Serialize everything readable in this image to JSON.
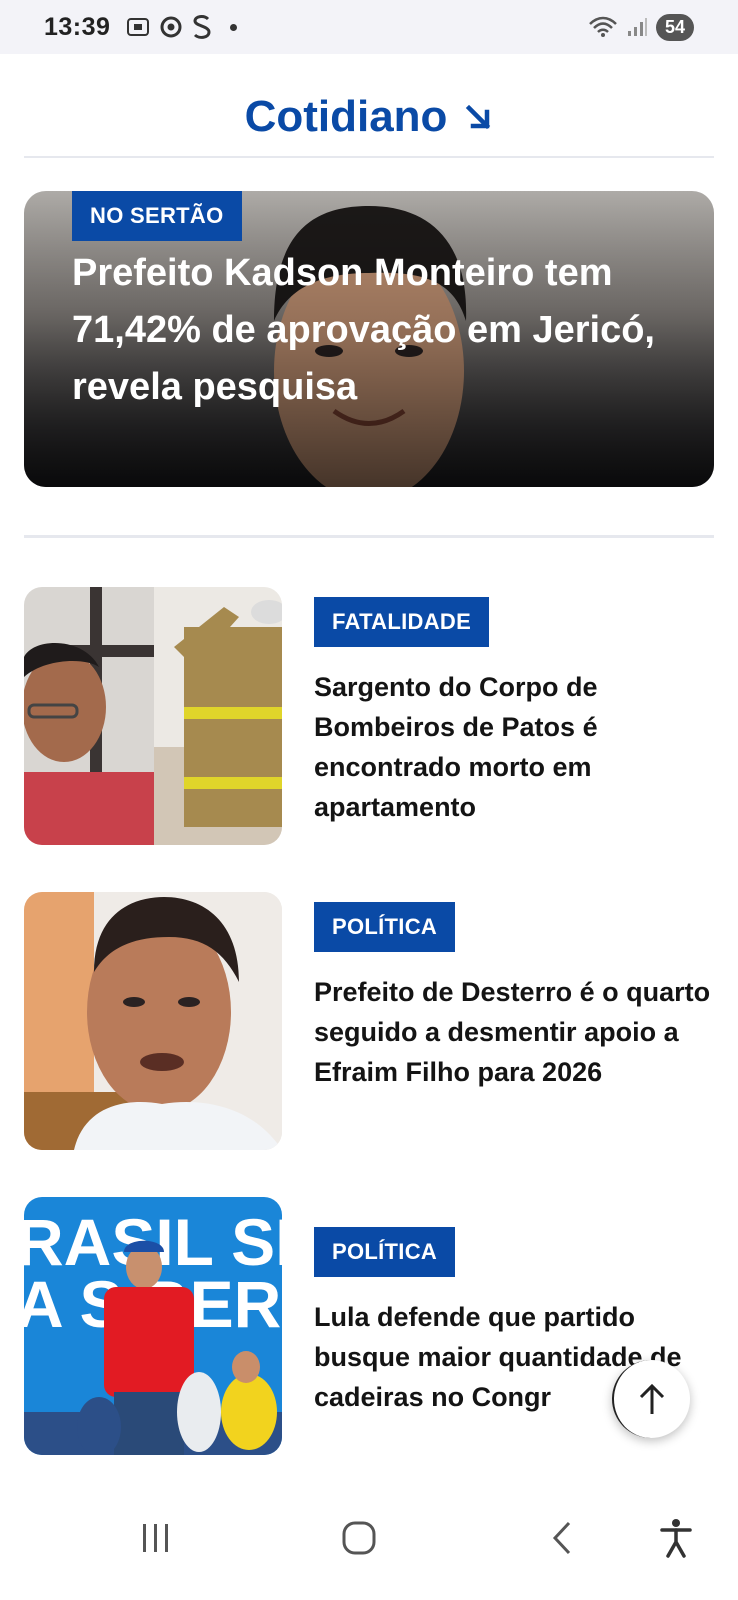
{
  "status_bar": {
    "time": "13:39",
    "battery": "54",
    "icons_left": [
      "screenshot-icon",
      "chrome-icon",
      "s-app-icon",
      "notification-dot"
    ],
    "icons_right": [
      "wifi-icon",
      "signal-icon",
      "battery-icon"
    ]
  },
  "section": {
    "title": "Cotidiano",
    "accent_color": "#0a4aa6",
    "icon": "arrow-down-right-icon"
  },
  "hero": {
    "tag": "NO SERTÃO",
    "title": "Prefeito Kadson Monteiro tem 71,42% de aprovação em Jericó, revela pesquisa"
  },
  "news": [
    {
      "tag": "FATALIDADE",
      "title": "Sargento do Corpo de Bombeiros de Patos é encontrado morto em apartamento"
    },
    {
      "tag": "POLÍTICA",
      "title": "Prefeito de Desterro é o quarto seguido a desmentir apoio a Efraim Filho para 2026"
    },
    {
      "tag": "POLÍTICA",
      "title": "Lula defende que partido busque maior quantidade de cadeiras no Congr"
    }
  ],
  "thumb3_banner": {
    "line1": "RASIL SE",
    "line2": "A S  BER"
  },
  "nav": [
    "recents-icon",
    "home-icon",
    "back-icon",
    "accessibility-icon"
  ]
}
